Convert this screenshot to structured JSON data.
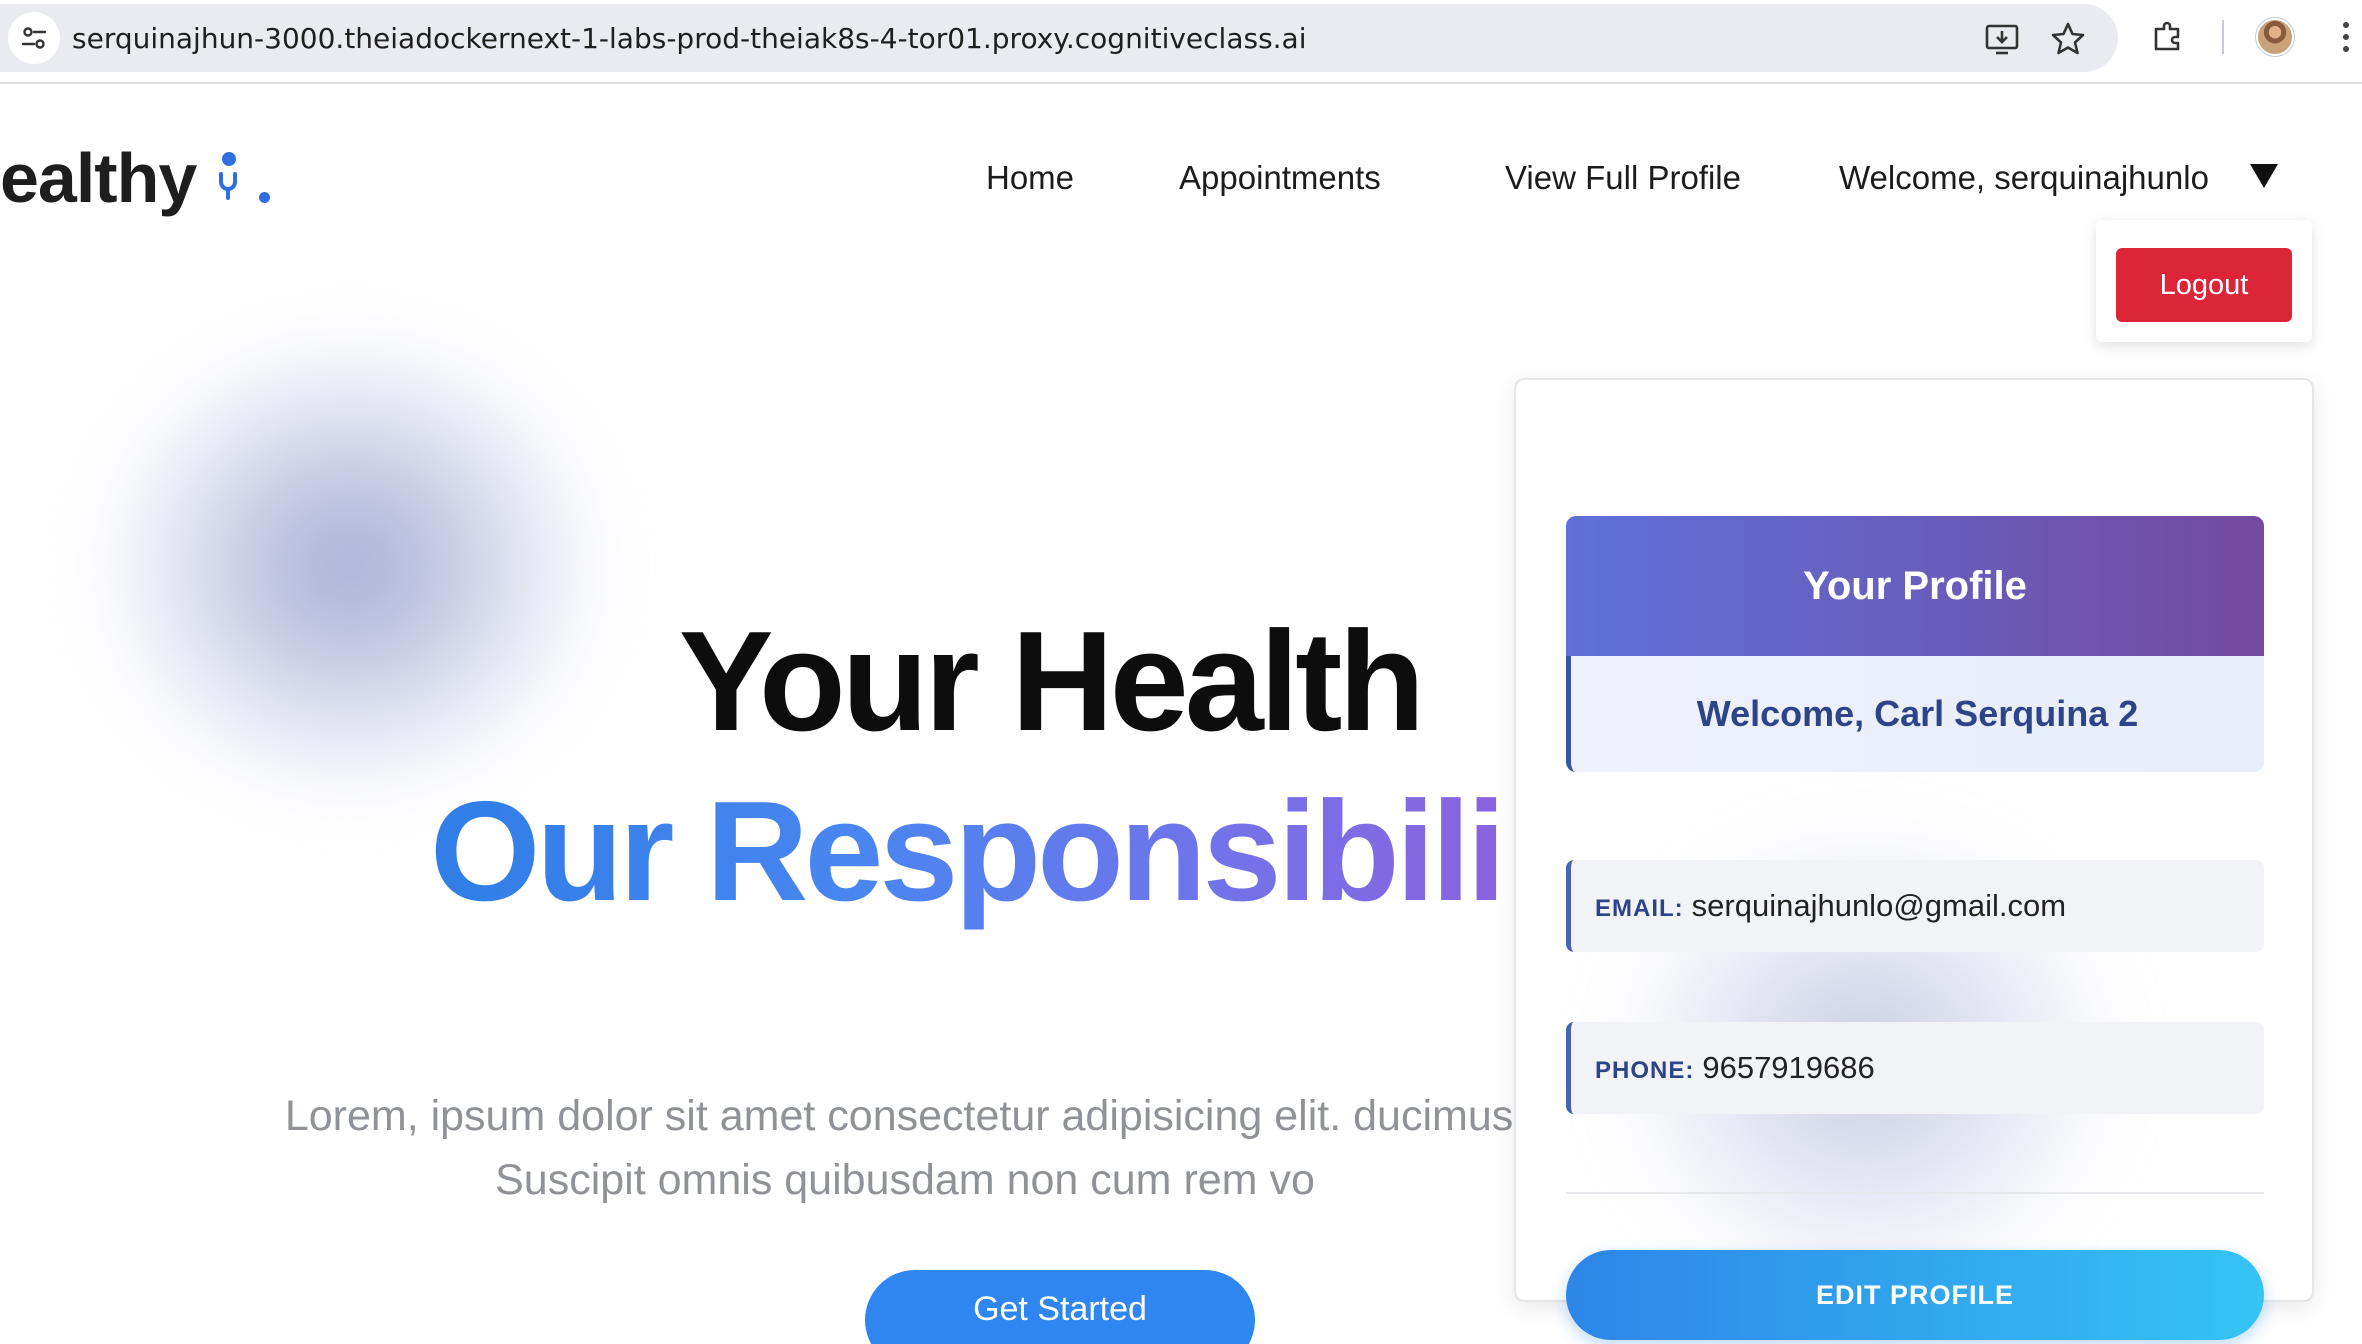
{
  "browser": {
    "url": "serquinajhun-3000.theiadockernext-1-labs-prod-theiak8s-4-tor01.proxy.cognitiveclass.ai",
    "icons": [
      "site-info-icon",
      "install-app-icon",
      "bookmark-star-icon",
      "extensions-icon",
      "profile-avatar",
      "more-menu-icon"
    ]
  },
  "logo": {
    "text": "ealthy"
  },
  "nav": {
    "home": "Home",
    "appointments": "Appointments",
    "full_profile": "View Full Profile",
    "welcome": "Welcome, serquinajhunlo",
    "logout": "Logout"
  },
  "hero": {
    "line1": "Your Health",
    "line2": "Our Responsibili",
    "body": "Lorem, ipsum dolor sit amet consectetur adipisicing elit. ducimus. Suscipit omnis quibusdam non cum rem vo",
    "cta": "Get Started"
  },
  "profile": {
    "title": "Your Profile",
    "welcome": "Welcome, Carl Serquina 2",
    "email_label": "EMAIL:",
    "email": "serquinajhunlo@gmail.com",
    "phone_label": "PHONE:",
    "phone": "9657919686",
    "edit": "EDIT PROFILE"
  },
  "colors": {
    "accent_blue": "#2f86f0",
    "logout_red": "#dc2638",
    "profile_header_start": "#5e71d8",
    "profile_header_end": "#744a9e",
    "profile_text": "#2d4488"
  }
}
